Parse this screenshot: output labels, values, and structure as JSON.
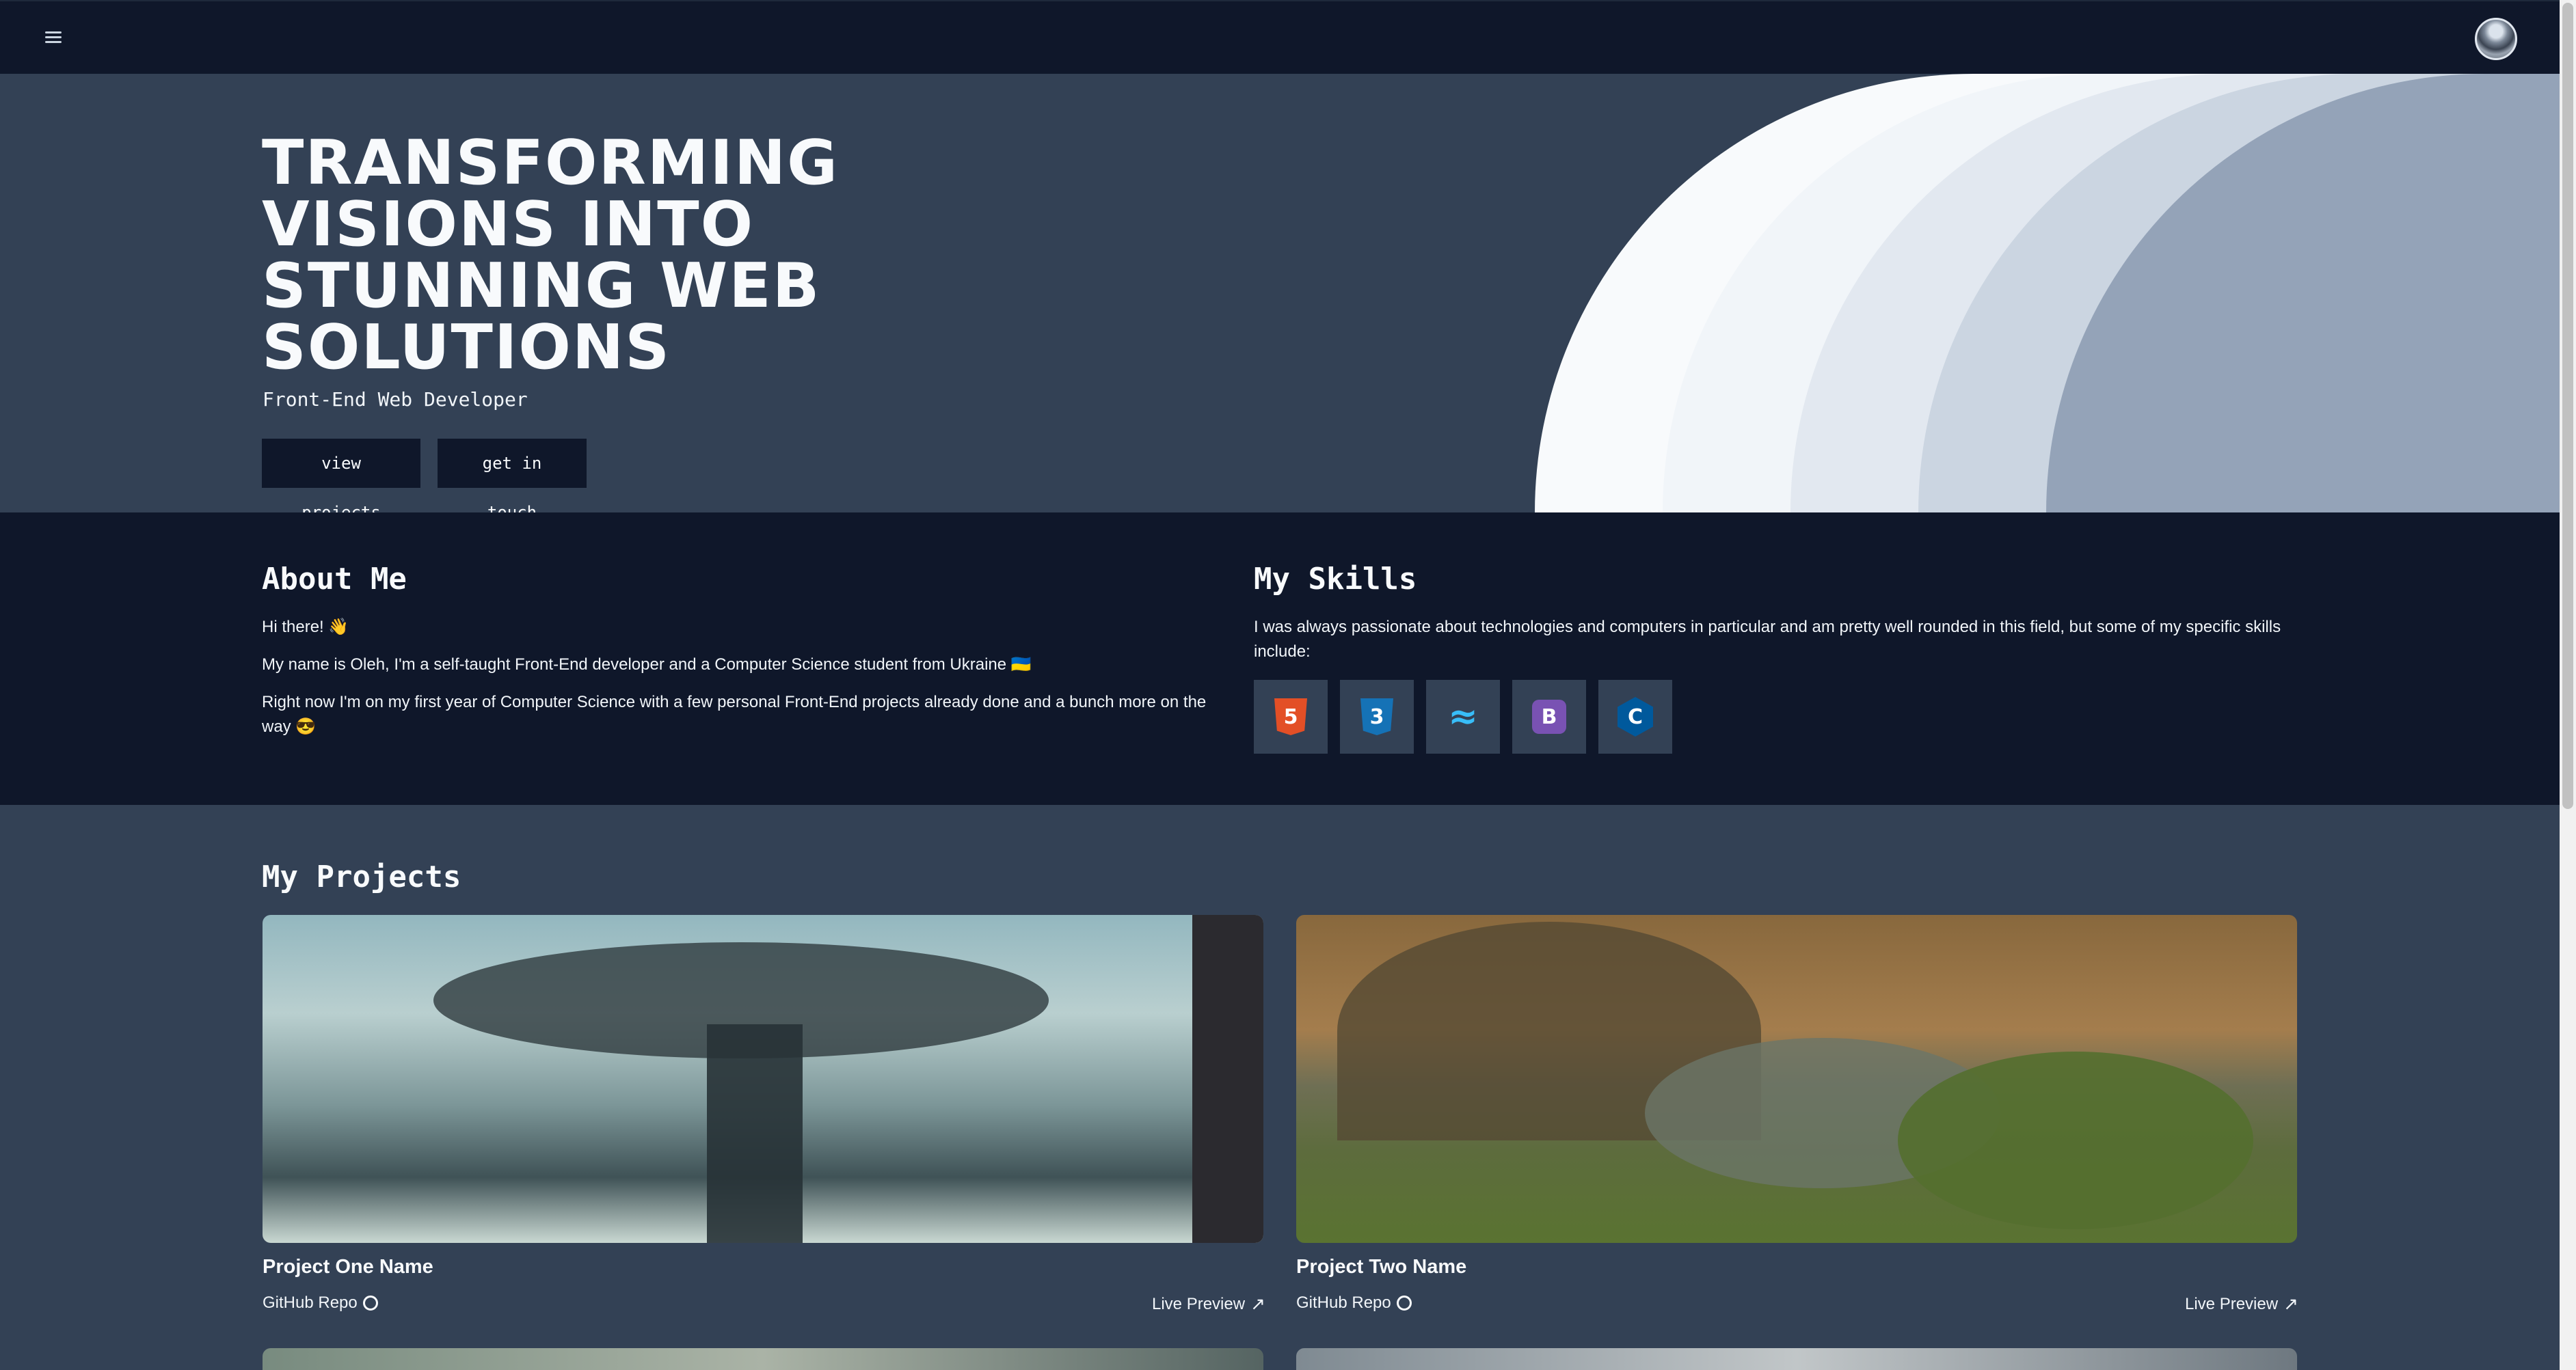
{
  "header": {
    "menu_icon": "hamburger-menu-icon",
    "avatar_icon": "user-avatar"
  },
  "hero": {
    "title": "TRANSFORMING VISIONS INTO STUNNING WEB SOLUTIONS",
    "subtitle": "Front-End Web Developer",
    "buttons": {
      "projects": "view projects",
      "contact": "get in touch"
    },
    "wave_colors": [
      "#f8fafc",
      "#f1f5f9",
      "#e2e8f0",
      "#cbd5e1",
      "#94a3b8"
    ]
  },
  "about": {
    "heading": "About Me",
    "greeting": "Hi there! 👋",
    "intro": "My name is Oleh, I'm a self-taught Front-End developer and a Computer Science student from Ukraine 🇺🇦",
    "details": "Right now I'm on my first year of Computer Science with a few personal Front-End projects already done and a bunch more on the way 😎"
  },
  "skills": {
    "heading": "My Skills",
    "description": "I was always passionate about technologies and computers in particular and am pretty well rounded in this field, but some of my specific skills include:",
    "items": [
      {
        "icon": "html5-icon",
        "glyph": "5",
        "color": "#e34f26"
      },
      {
        "icon": "css3-icon",
        "glyph": "3",
        "color": "#1572b6"
      },
      {
        "icon": "tailwind-icon",
        "glyph": "≈",
        "color": "#38bdf8"
      },
      {
        "icon": "bootstrap-icon",
        "glyph": "B",
        "color": "#7952b3"
      },
      {
        "icon": "cplusplus-icon",
        "glyph": "C",
        "color": "#00599c"
      }
    ]
  },
  "projects": {
    "heading": "My Projects",
    "items": [
      {
        "name": "Project One Name",
        "repo_label": "GitHub Repo",
        "preview_label": "Live Preview"
      },
      {
        "name": "Project Two Name",
        "repo_label": "GitHub Repo",
        "preview_label": "Live Preview"
      }
    ]
  },
  "colors": {
    "dark": "#0f172a",
    "slate": "#334155"
  }
}
